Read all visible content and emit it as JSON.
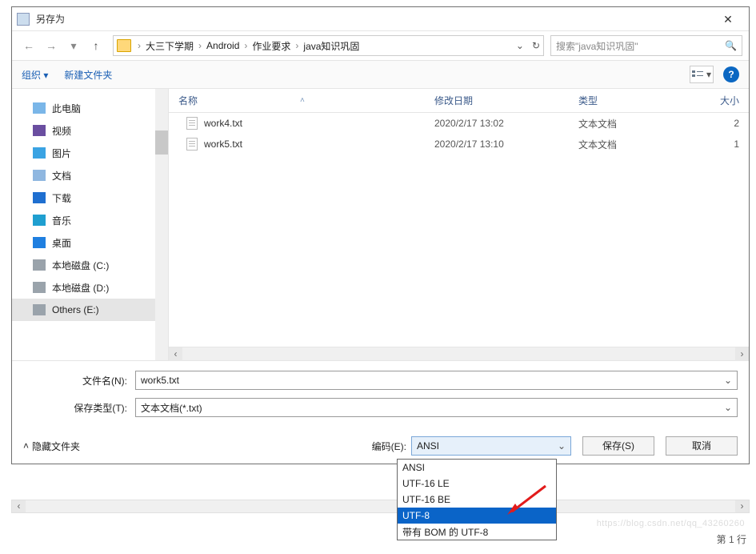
{
  "title": "另存为",
  "nav": {
    "back": "←",
    "fwd": "→",
    "down": "▾",
    "up": "↑",
    "crumbs": [
      "大三下学期",
      "Android",
      "作业要求",
      "java知识巩固"
    ],
    "refresh": "↻",
    "search_placeholder": "搜索\"java知识巩固\"",
    "search_icon": "🔍"
  },
  "toolbar": {
    "organize": "组织 ▾",
    "newfolder": "新建文件夹",
    "help": "?"
  },
  "sidebar": {
    "items": [
      {
        "label": "此电脑",
        "ico": "#7ab6e8"
      },
      {
        "label": "视频",
        "ico": "#6a4ea0"
      },
      {
        "label": "图片",
        "ico": "#3aa3e3"
      },
      {
        "label": "文档",
        "ico": "#8fb7e0"
      },
      {
        "label": "下载",
        "ico": "#1f6fd0"
      },
      {
        "label": "音乐",
        "ico": "#1f9fd0"
      },
      {
        "label": "桌面",
        "ico": "#1f7fe0"
      },
      {
        "label": "本地磁盘 (C:)",
        "ico": "#9aa3ab"
      },
      {
        "label": "本地磁盘 (D:)",
        "ico": "#9aa3ab"
      },
      {
        "label": "Others (E:)",
        "ico": "#9aa3ab"
      }
    ]
  },
  "columns": {
    "name": "名称",
    "date": "修改日期",
    "type": "类型",
    "size": "大小"
  },
  "files": [
    {
      "name": "work4.txt",
      "date": "2020/2/17 13:02",
      "type": "文本文档",
      "size": "2"
    },
    {
      "name": "work5.txt",
      "date": "2020/2/17 13:10",
      "type": "文本文档",
      "size": "1"
    }
  ],
  "fields": {
    "filename_label": "文件名(N):",
    "filename_value": "work5.txt",
    "type_label": "保存类型(T):",
    "type_value": "文本文档(*.txt)",
    "hide_label": "隐藏文件夹",
    "encoding_label": "编码(E):",
    "encoding_value": "ANSI",
    "save": "保存(S)",
    "cancel": "取消"
  },
  "encoding_options": [
    "ANSI",
    "UTF-16 LE",
    "UTF-16 BE",
    "UTF-8",
    "带有 BOM 的 UTF-8"
  ],
  "encoding_selected_index": 3,
  "statusbar": "第 1 行",
  "watermark": "https://blog.csdn.net/qq_43260260"
}
